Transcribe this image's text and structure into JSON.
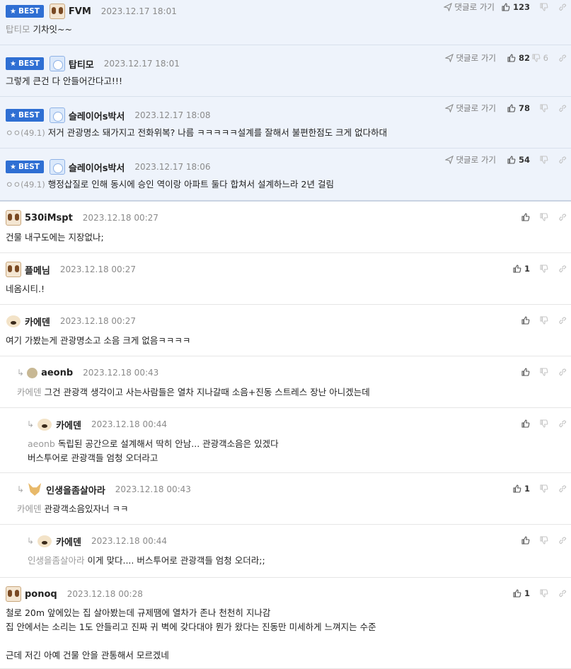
{
  "labels": {
    "best": "BEST",
    "goto": "댓글로 가기"
  },
  "colors": {
    "best_badge": "#2f6fd3",
    "best_row_bg": "#eef3fb",
    "date": "#8a8a8a",
    "mention": "#9a9a9a"
  },
  "icons": {
    "best": "star-icon",
    "goto": "send-arrow-icon",
    "up": "thumbs-up-icon",
    "down": "thumbs-down-icon",
    "link": "link-icon",
    "reply": "reply-arrow-icon"
  },
  "comments": [
    {
      "best": true,
      "avatar": "dog",
      "nick": "FVM",
      "date": "2023.12.17 18:01",
      "level": "",
      "mention": "탑티모",
      "text": "기차잇~~",
      "up": "123",
      "down": ""
    },
    {
      "best": true,
      "avatar": "bear",
      "nick": "탑티모",
      "date": "2023.12.17 18:01",
      "level": "",
      "mention": "",
      "text": "그렇게 큰건 다 안들어간다고!!!",
      "up": "82",
      "down": "6"
    },
    {
      "best": true,
      "avatar": "bear",
      "nick": "슬레이어s박서",
      "date": "2023.12.17 18:08",
      "level": "ㅇㅇ(49.1)",
      "mention": "",
      "text": "저거 관광명소 돼가지고 전화위복? 나름 ㅋㅋㅋㅋㅋ설계를 잘해서 불편한점도 크게 없다하대",
      "up": "78",
      "down": ""
    },
    {
      "best": true,
      "avatar": "bear",
      "nick": "슬레이어s박서",
      "date": "2023.12.17 18:06",
      "level": "ㅇㅇ(49.1)",
      "mention": "",
      "text": "행정삽질로 인해 동시에 승인 역이랑 아파트 둘다 합쳐서 설계하느라 2년 걸림",
      "up": "54",
      "down": ""
    },
    {
      "best": false,
      "avatar": "dog",
      "nick": "530iMspt",
      "date": "2023.12.18 00:27",
      "level": "",
      "mention": "",
      "text": "건물 내구도에는 지장없나;",
      "up": "",
      "down": ""
    },
    {
      "best": false,
      "avatar": "dog",
      "nick": "플메님",
      "date": "2023.12.18 00:27",
      "level": "",
      "mention": "",
      "text": "네옴시티.!",
      "up": "1",
      "down": ""
    },
    {
      "best": false,
      "avatar": "pup",
      "nick": "카에덴",
      "date": "2023.12.18 00:27",
      "level": "",
      "mention": "",
      "text": "여기 가봤는게 관광명소고 소음 크게 없음ㅋㅋㅋㅋ",
      "up": "",
      "down": ""
    },
    {
      "best": false,
      "depth": 1,
      "avatar": "round",
      "nick": "aeonb",
      "date": "2023.12.18 00:43",
      "level": "",
      "mention": "카에덴",
      "text": "그건 관광객 생각이고 사는사람들은 열차 지나갈때 소음+진동 스트레스 장난 아니겠는데",
      "up": "",
      "down": ""
    },
    {
      "best": false,
      "depth": 2,
      "avatar": "pup",
      "nick": "카에덴",
      "date": "2023.12.18 00:44",
      "level": "",
      "mention": "aeonb",
      "text": "독립된 공간으로 설계해서 딱히 안남... 관광객소음은 있겠다\n버스투어로 관광객들 엄청 오더라고",
      "up": "",
      "down": ""
    },
    {
      "best": false,
      "depth": 1,
      "avatar": "fox",
      "nick": "인생을좀살아라",
      "date": "2023.12.18 00:43",
      "level": "",
      "mention": "카에덴",
      "text": "관광객소음있자너 ㅋㅋ",
      "up": "1",
      "down": ""
    },
    {
      "best": false,
      "depth": 2,
      "avatar": "pup",
      "nick": "카에덴",
      "date": "2023.12.18 00:44",
      "level": "",
      "mention": "인생을좀살아라",
      "text": "이게 맞다.... 버스투어로 관광객들 엄청 오더라;;",
      "up": "",
      "down": ""
    },
    {
      "best": false,
      "avatar": "dog",
      "nick": "ponoq",
      "date": "2023.12.18 00:28",
      "level": "",
      "mention": "",
      "text": "철로 20m 앞에있는 집 살아봤는데 규제땜에 열차가 존나 천천히 지나감\n집 안에서는 소리는 1도 안들리고 진짜 귀 벽에 갖다대야 뭔가 왔다는 진동만 미세하게 느껴지는 수준\n\n근데 저긴 아예 건물 안을 관통해서 모르겠네",
      "up": "1",
      "down": ""
    }
  ]
}
